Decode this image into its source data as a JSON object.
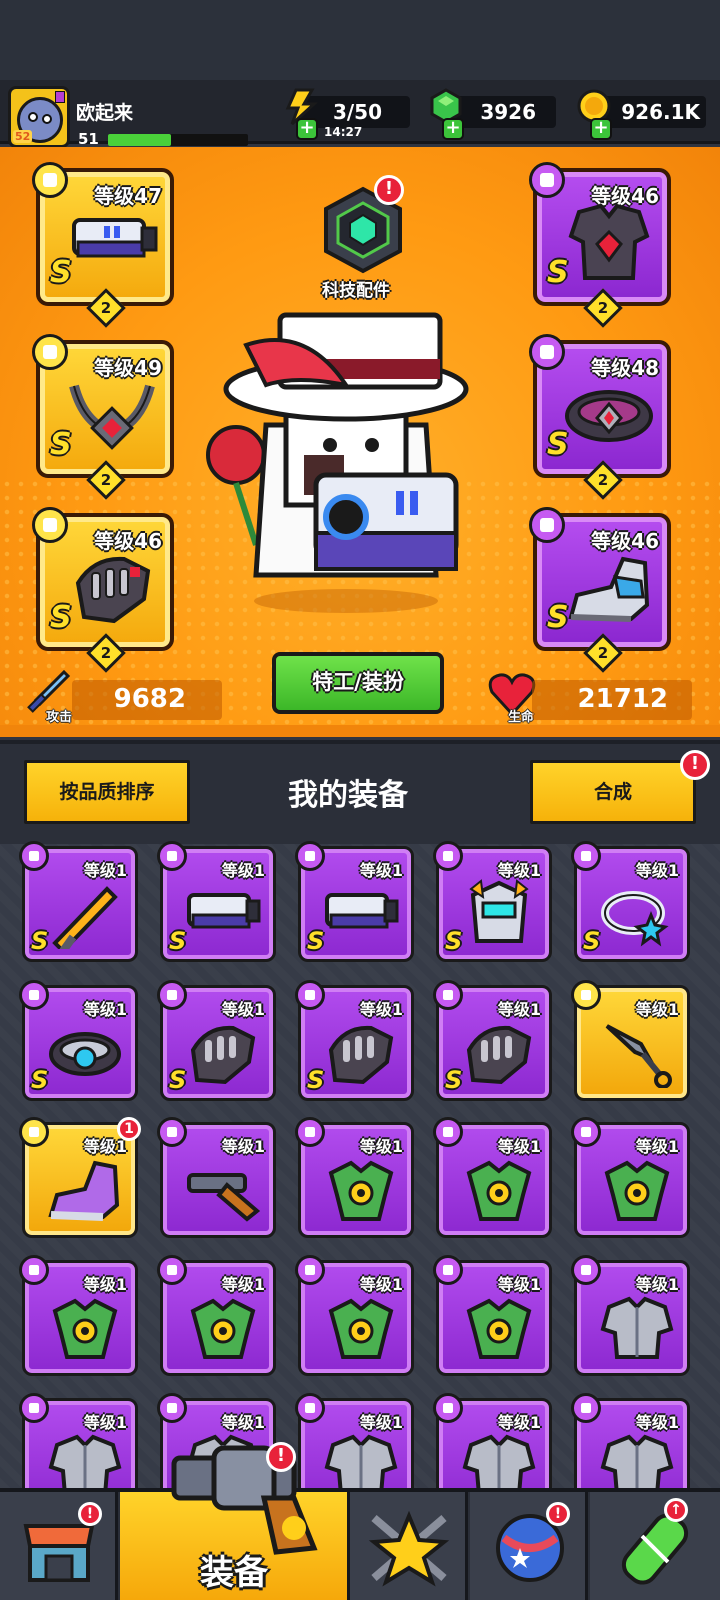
{
  "player": {
    "name": "欧起来",
    "level": "51",
    "avatar_level": "52",
    "xp_fraction": 0.45
  },
  "resources": {
    "energy": {
      "value": "3/50",
      "timer": "14:27",
      "icon": "lightning-icon"
    },
    "gems": {
      "value": "3926",
      "icon": "green-gem-icon"
    },
    "coins": {
      "value": "926.1K",
      "icon": "gold-coin-icon"
    }
  },
  "equipped": {
    "left": [
      {
        "level": "等级47",
        "rank": "S",
        "stars": "2",
        "item": "blaster-icon"
      },
      {
        "level": "等级49",
        "rank": "S",
        "stars": "2",
        "item": "chain-necklace-icon"
      },
      {
        "level": "等级46",
        "rank": "S",
        "stars": "2",
        "item": "gauntlet-icon"
      }
    ],
    "right": [
      {
        "level": "等级46",
        "rank": "S",
        "stars": "2",
        "item": "armor-icon"
      },
      {
        "level": "等级48",
        "rank": "S",
        "stars": "2",
        "item": "belt-icon"
      },
      {
        "level": "等级46",
        "rank": "S",
        "stars": "2",
        "item": "sneaker-icon"
      }
    ]
  },
  "tech": {
    "label": "科技配件",
    "alert": "!"
  },
  "costume_button": "特工/装扮",
  "stats": {
    "attack_label": "攻击",
    "attack": "9682",
    "hp_label": "生命",
    "hp": "21712"
  },
  "inventory": {
    "sort_button": "按品质排序",
    "title": "我的装备",
    "merge_button": "合成",
    "merge_alert": "!",
    "items": [
      {
        "level": "等级1",
        "rank": "S",
        "quality": "purple",
        "item": "sword-icon"
      },
      {
        "level": "等级1",
        "rank": "S",
        "quality": "purple",
        "item": "blaster-icon"
      },
      {
        "level": "等级1",
        "rank": "S",
        "quality": "purple",
        "item": "blaster-icon"
      },
      {
        "level": "等级1",
        "rank": "S",
        "quality": "purple",
        "item": "robot-helmet-armor-icon"
      },
      {
        "level": "等级1",
        "rank": "S",
        "quality": "purple",
        "item": "star-ring-icon"
      },
      {
        "level": "等级1",
        "rank": "S",
        "quality": "purple",
        "item": "belt-icon"
      },
      {
        "level": "等级1",
        "rank": "S",
        "quality": "purple",
        "item": "gauntlet-icon"
      },
      {
        "level": "等级1",
        "rank": "S",
        "quality": "purple",
        "item": "gauntlet-icon"
      },
      {
        "level": "等级1",
        "rank": "S",
        "quality": "purple",
        "item": "gauntlet-icon"
      },
      {
        "level": "等级1",
        "rank": "",
        "quality": "gold",
        "item": "kunai-icon"
      },
      {
        "level": "等级1",
        "rank": "",
        "quality": "gold",
        "item": "sneaker-icon",
        "alert": "1"
      },
      {
        "level": "等级1",
        "rank": "",
        "quality": "purple",
        "item": "shotgun-icon"
      },
      {
        "level": "等级1",
        "rank": "",
        "quality": "purple",
        "item": "leaf-armor-icon"
      },
      {
        "level": "等级1",
        "rank": "",
        "quality": "purple",
        "item": "leaf-armor-icon"
      },
      {
        "level": "等级1",
        "rank": "",
        "quality": "purple",
        "item": "leaf-armor-icon"
      },
      {
        "level": "等级1",
        "rank": "",
        "quality": "purple",
        "item": "leaf-armor-icon"
      },
      {
        "level": "等级1",
        "rank": "",
        "quality": "purple",
        "item": "leaf-armor-icon"
      },
      {
        "level": "等级1",
        "rank": "",
        "quality": "purple",
        "item": "leaf-armor-icon"
      },
      {
        "level": "等级1",
        "rank": "",
        "quality": "purple",
        "item": "leaf-armor-icon"
      },
      {
        "level": "等级1",
        "rank": "",
        "quality": "purple",
        "item": "steel-armor-icon"
      },
      {
        "level": "等级1",
        "rank": "",
        "quality": "purple",
        "item": "steel-armor-icon"
      },
      {
        "level": "等级1",
        "rank": "",
        "quality": "purple",
        "item": "steel-armor-icon"
      },
      {
        "level": "等级1",
        "rank": "",
        "quality": "purple",
        "item": "steel-armor-icon"
      },
      {
        "level": "等级1",
        "rank": "",
        "quality": "purple",
        "item": "steel-armor-icon"
      },
      {
        "level": "等级1",
        "rank": "",
        "quality": "purple",
        "item": "steel-armor-icon"
      }
    ]
  },
  "nav": {
    "shop_icon": "shop-icon",
    "equipment_label": "装备",
    "talent_icon": "star-swords-icon",
    "planet_icon": "star-planet-icon",
    "dna_icon": "dna-capsule-icon"
  },
  "colors": {
    "gold": "#f6b20a",
    "purple": "#9b33dc",
    "hero_bg": "#ff9a12",
    "alert": "#e8223a",
    "green_btn": "#3cb728"
  }
}
